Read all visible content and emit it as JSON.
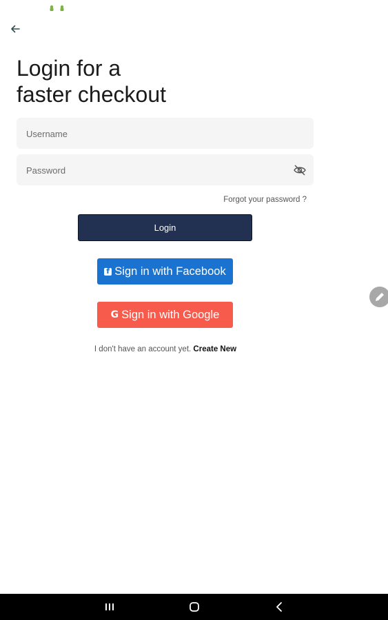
{
  "colors": {
    "primary_button": "#223052",
    "facebook": "#1a73d0",
    "google": "#f65b4c",
    "field_bg": "#f5f5f5",
    "nav_bar": "#000000"
  },
  "status_bar": {
    "icons": [
      "android-icon",
      "android-icon"
    ]
  },
  "header": {
    "back_icon": "arrow-left-icon",
    "title": "Login for a\nfaster checkout"
  },
  "form": {
    "username": {
      "placeholder": "Username",
      "value": ""
    },
    "password": {
      "placeholder": "Password",
      "value": "",
      "toggle_icon": "eye-off-icon"
    },
    "forgot_link": "Forgot your password ?",
    "login_button": "Login"
  },
  "social": {
    "facebook_label": "Sign in with Facebook",
    "facebook_icon": "facebook-icon",
    "google_label": "Sign in with Google",
    "google_icon": "google-icon"
  },
  "signup": {
    "prompt": "I don't have an account yet.",
    "link": "Create New"
  },
  "floating_button": {
    "icon": "pencil-icon"
  },
  "nav_bar": {
    "icons": [
      "recents-icon",
      "home-icon",
      "back-icon"
    ]
  }
}
